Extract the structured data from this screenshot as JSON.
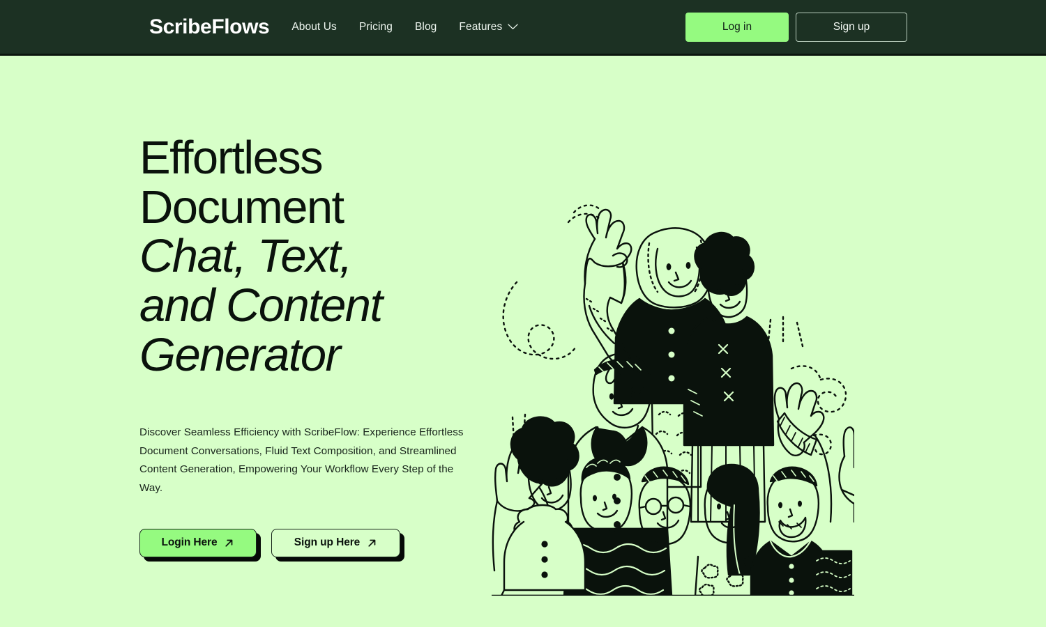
{
  "theme": {
    "header_bg": "#1c3123",
    "page_bg": "#d7ffc8",
    "accent_green": "#95fa80",
    "ink": "#0a120c",
    "nav_text": "#eef6ef"
  },
  "header": {
    "logo": "ScribeFlows",
    "nav": [
      {
        "label": "About Us",
        "has_dropdown": false
      },
      {
        "label": "Pricing",
        "has_dropdown": false
      },
      {
        "label": "Blog",
        "has_dropdown": false
      },
      {
        "label": "Features",
        "has_dropdown": true
      }
    ],
    "login_label": "Log in",
    "signup_label": "Sign up",
    "chevron_icon": "chevron-down-icon"
  },
  "hero": {
    "headline_line1": "Effortless",
    "headline_line2": "Document",
    "headline_italic_line1": "Chat, Text,",
    "headline_italic_line2": "and Content",
    "headline_italic_line3": "Generator",
    "subtext": "Discover Seamless Efficiency with ScribeFlow: Experience Effortless Document Conversations, Fluid Text Composition, and Streamlined Content Generation, Empowering Your Workflow Every Step of the Way.",
    "cta_primary": "Login Here",
    "cta_secondary": "Sign up Here",
    "cta_arrow_icon": "arrow-up-right-icon",
    "illustration": "crowd-of-people-raising-hands-illustration"
  }
}
